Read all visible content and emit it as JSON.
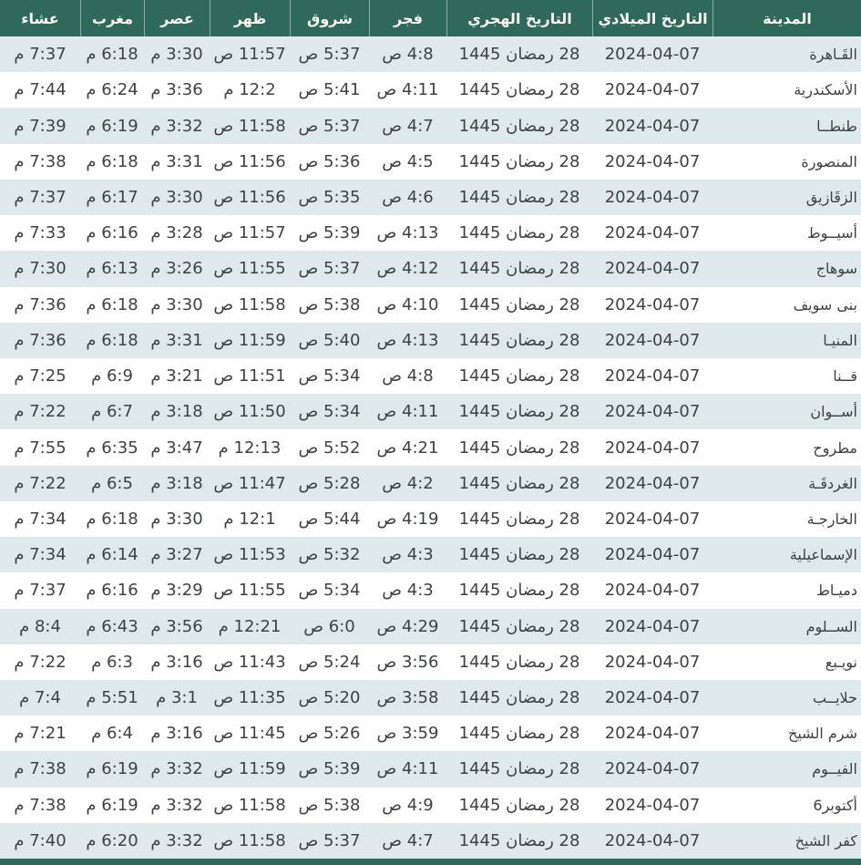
{
  "colors": {
    "header_bg": "#2f695c",
    "header_text": "#faf7ee",
    "stripe_bg": "#dfe8ea",
    "row_bg": "#ffffff",
    "body_text": "#3e4244"
  },
  "table": {
    "columns": [
      {
        "key": "city",
        "label": "المدينة"
      },
      {
        "key": "gregorian_date",
        "label": "التاريخ الميلادي"
      },
      {
        "key": "hijri_date",
        "label": "التاريخ الهجري"
      },
      {
        "key": "fajr",
        "label": "فجر"
      },
      {
        "key": "shurooq",
        "label": "شروق"
      },
      {
        "key": "dhuhr",
        "label": "ظهر"
      },
      {
        "key": "asr",
        "label": "عصر"
      },
      {
        "key": "maghrib",
        "label": "مغرب"
      },
      {
        "key": "isha",
        "label": "عشاء"
      }
    ],
    "rows": [
      {
        "city": "القَـاهرة",
        "gregorian_date": "2024-04-07",
        "hijri_date": "28 رمضان 1445",
        "fajr": "4:8 ص",
        "shurooq": "5:37 ص",
        "dhuhr": "11:57 ص",
        "asr": "3:30 م",
        "maghrib": "6:18 م",
        "isha": "7:37 م"
      },
      {
        "city": "الأسكندرية",
        "gregorian_date": "2024-04-07",
        "hijri_date": "28 رمضان 1445",
        "fajr": "4:11 ص",
        "shurooq": "5:41 ص",
        "dhuhr": "12:2 م",
        "asr": "3:36 م",
        "maghrib": "6:24 م",
        "isha": "7:44 م"
      },
      {
        "city": "طنطــا",
        "gregorian_date": "2024-04-07",
        "hijri_date": "28 رمضان 1445",
        "fajr": "4:7 ص",
        "shurooq": "5:37 ص",
        "dhuhr": "11:58 ص",
        "asr": "3:32 م",
        "maghrib": "6:19 م",
        "isha": "7:39 م"
      },
      {
        "city": "المنصورة",
        "gregorian_date": "2024-04-07",
        "hijri_date": "28 رمضان 1445",
        "fajr": "4:5 ص",
        "shurooq": "5:36 ص",
        "dhuhr": "11:56 ص",
        "asr": "3:31 م",
        "maghrib": "6:18 م",
        "isha": "7:38 م"
      },
      {
        "city": "الزقَازيق",
        "gregorian_date": "2024-04-07",
        "hijri_date": "28 رمضان 1445",
        "fajr": "4:6 ص",
        "shurooq": "5:35 ص",
        "dhuhr": "11:56 ص",
        "asr": "3:30 م",
        "maghrib": "6:17 م",
        "isha": "7:37 م"
      },
      {
        "city": "أسيــوط",
        "gregorian_date": "2024-04-07",
        "hijri_date": "28 رمضان 1445",
        "fajr": "4:13 ص",
        "shurooq": "5:39 ص",
        "dhuhr": "11:57 ص",
        "asr": "3:28 م",
        "maghrib": "6:16 م",
        "isha": "7:33 م"
      },
      {
        "city": "سوهاج",
        "gregorian_date": "2024-04-07",
        "hijri_date": "28 رمضان 1445",
        "fajr": "4:12 ص",
        "shurooq": "5:37 ص",
        "dhuhr": "11:55 ص",
        "asr": "3:26 م",
        "maghrib": "6:13 م",
        "isha": "7:30 م"
      },
      {
        "city": "بنى سويف",
        "gregorian_date": "2024-04-07",
        "hijri_date": "28 رمضان 1445",
        "fajr": "4:10 ص",
        "shurooq": "5:38 ص",
        "dhuhr": "11:58 ص",
        "asr": "3:30 م",
        "maghrib": "6:18 م",
        "isha": "7:36 م"
      },
      {
        "city": "المنيـا",
        "gregorian_date": "2024-04-07",
        "hijri_date": "28 رمضان 1445",
        "fajr": "4:13 ص",
        "shurooq": "5:40 ص",
        "dhuhr": "11:59 ص",
        "asr": "3:31 م",
        "maghrib": "6:18 م",
        "isha": "7:36 م"
      },
      {
        "city": "قــنا",
        "gregorian_date": "2024-04-07",
        "hijri_date": "28 رمضان 1445",
        "fajr": "4:8 ص",
        "shurooq": "5:34 ص",
        "dhuhr": "11:51 ص",
        "asr": "3:21 م",
        "maghrib": "6:9 م",
        "isha": "7:25 م"
      },
      {
        "city": "أســوان",
        "gregorian_date": "2024-04-07",
        "hijri_date": "28 رمضان 1445",
        "fajr": "4:11 ص",
        "shurooq": "5:34 ص",
        "dhuhr": "11:50 ص",
        "asr": "3:18 م",
        "maghrib": "6:7 م",
        "isha": "7:22 م"
      },
      {
        "city": "مطروح",
        "gregorian_date": "2024-04-07",
        "hijri_date": "28 رمضان 1445",
        "fajr": "4:21 ص",
        "shurooq": "5:52 ص",
        "dhuhr": "12:13 م",
        "asr": "3:47 م",
        "maghrib": "6:35 م",
        "isha": "7:55 م"
      },
      {
        "city": "الغردقَـة",
        "gregorian_date": "2024-04-07",
        "hijri_date": "28 رمضان 1445",
        "fajr": "4:2 ص",
        "shurooq": "5:28 ص",
        "dhuhr": "11:47 ص",
        "asr": "3:18 م",
        "maghrib": "6:5 م",
        "isha": "7:22 م"
      },
      {
        "city": "الخارجـة",
        "gregorian_date": "2024-04-07",
        "hijri_date": "28 رمضان 1445",
        "fajr": "4:19 ص",
        "shurooq": "5:44 ص",
        "dhuhr": "12:1 م",
        "asr": "3:30 م",
        "maghrib": "6:18 م",
        "isha": "7:34 م"
      },
      {
        "city": "الإسماعيلية",
        "gregorian_date": "2024-04-07",
        "hijri_date": "28 رمضان 1445",
        "fajr": "4:3 ص",
        "shurooq": "5:32 ص",
        "dhuhr": "11:53 ص",
        "asr": "3:27 م",
        "maghrib": "6:14 م",
        "isha": "7:34 م"
      },
      {
        "city": "دميـاط",
        "gregorian_date": "2024-04-07",
        "hijri_date": "28 رمضان 1445",
        "fajr": "4:3 ص",
        "shurooq": "5:34 ص",
        "dhuhr": "11:55 ص",
        "asr": "3:29 م",
        "maghrib": "6:16 م",
        "isha": "7:37 م"
      },
      {
        "city": "الســلوم",
        "gregorian_date": "2024-04-07",
        "hijri_date": "28 رمضان 1445",
        "fajr": "4:29 ص",
        "shurooq": "6:0 ص",
        "dhuhr": "12:21 م",
        "asr": "3:56 م",
        "maghrib": "6:43 م",
        "isha": "8:4 م"
      },
      {
        "city": "نويـبع",
        "gregorian_date": "2024-04-07",
        "hijri_date": "28 رمضان 1445",
        "fajr": "3:56 ص",
        "shurooq": "5:24 ص",
        "dhuhr": "11:43 ص",
        "asr": "3:16 م",
        "maghrib": "6:3 م",
        "isha": "7:22 م"
      },
      {
        "city": "حلايــب",
        "gregorian_date": "2024-04-07",
        "hijri_date": "28 رمضان 1445",
        "fajr": "3:58 ص",
        "shurooq": "5:20 ص",
        "dhuhr": "11:35 ص",
        "asr": "3:1 م",
        "maghrib": "5:51 م",
        "isha": "7:4 م"
      },
      {
        "city": "شرم الشيخ",
        "gregorian_date": "2024-04-07",
        "hijri_date": "28 رمضان 1445",
        "fajr": "3:59 ص",
        "shurooq": "5:26 ص",
        "dhuhr": "11:45 ص",
        "asr": "3:16 م",
        "maghrib": "6:4 م",
        "isha": "7:21 م"
      },
      {
        "city": "الفيــوم",
        "gregorian_date": "2024-04-07",
        "hijri_date": "28 رمضان 1445",
        "fajr": "4:11 ص",
        "shurooq": "5:39 ص",
        "dhuhr": "11:59 ص",
        "asr": "3:32 م",
        "maghrib": "6:19 م",
        "isha": "7:38 م"
      },
      {
        "city": "أكتوبر6",
        "gregorian_date": "2024-04-07",
        "hijri_date": "28 رمضان 1445",
        "fajr": "4:9 ص",
        "shurooq": "5:38 ص",
        "dhuhr": "11:58 ص",
        "asr": "3:32 م",
        "maghrib": "6:19 م",
        "isha": "7:38 م"
      },
      {
        "city": "كفر الشيخ",
        "gregorian_date": "2024-04-07",
        "hijri_date": "28 رمضان 1445",
        "fajr": "4:7 ص",
        "shurooq": "5:37 ص",
        "dhuhr": "11:58 ص",
        "asr": "3:32 م",
        "maghrib": "6:20 م",
        "isha": "7:40 م"
      }
    ]
  }
}
